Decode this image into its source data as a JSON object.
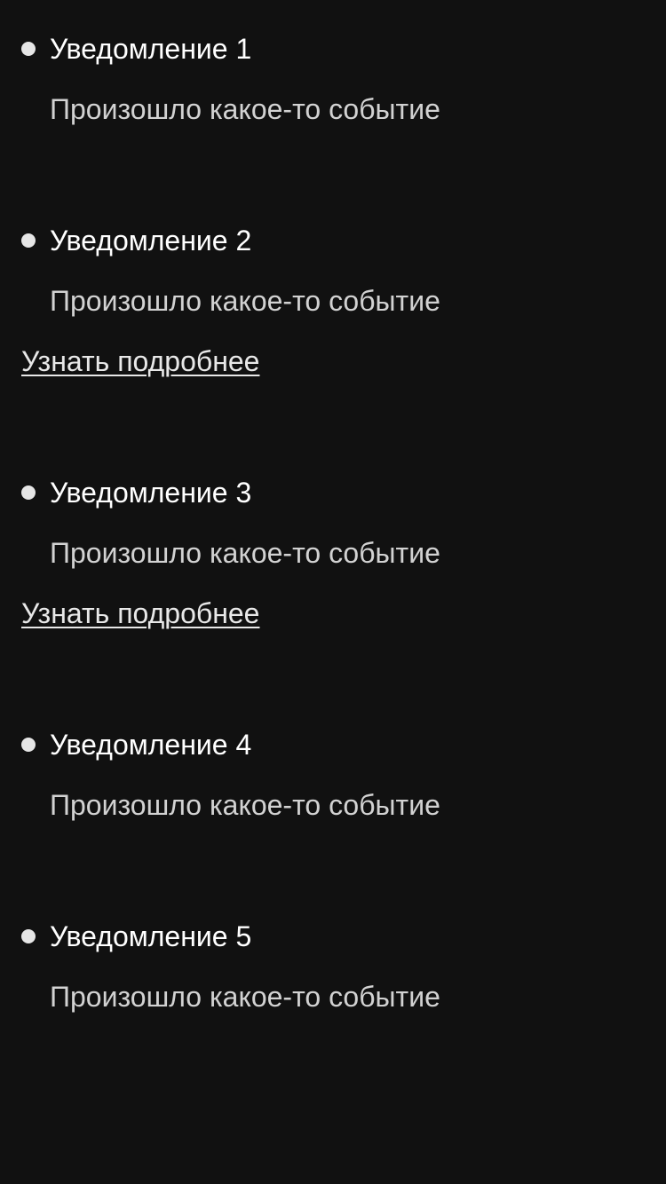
{
  "notifications": [
    {
      "title": "Уведомление 1",
      "text": "Произошло какое-то событие",
      "more": ""
    },
    {
      "title": "Уведомление 2",
      "text": "Произошло какое-то событие",
      "more": "Узнать подробнее"
    },
    {
      "title": "Уведомление 3",
      "text": "Произошло какое-то событие",
      "more": "Узнать подробнее"
    },
    {
      "title": "Уведомление 4",
      "text": "Произошло какое-то событие",
      "more": ""
    },
    {
      "title": "Уведомление 5",
      "text": "Произошло какое-то событие",
      "more": ""
    }
  ],
  "colors": {
    "background": "#111111",
    "title": "#ffffff",
    "text": "#d2d2d2",
    "bullet": "#e6e6e6",
    "link": "#e8e8e8"
  },
  "icons": {
    "bullet": "bullet-icon"
  }
}
